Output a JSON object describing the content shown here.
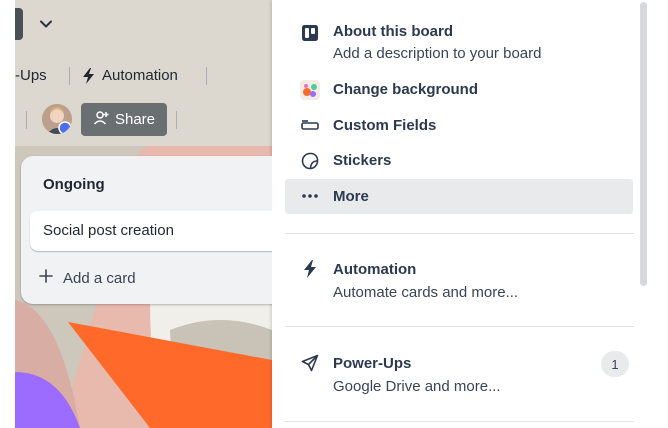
{
  "board": {
    "toolbar": {
      "powerups_label": "-Ups",
      "automation_label": "Automation",
      "share_label": "Share"
    },
    "list": {
      "title": "Ongoing",
      "cards": [
        {
          "title": "Social post creation"
        }
      ],
      "add_card_label": "Add a card"
    }
  },
  "menu": {
    "items": [
      {
        "icon": "board-icon",
        "title": "About this board",
        "subtitle": "Add a description to your board"
      },
      {
        "icon": "palette-icon",
        "title": "Change background"
      },
      {
        "icon": "custom-fields-icon",
        "title": "Custom Fields"
      },
      {
        "icon": "sticker-icon",
        "title": "Stickers"
      },
      {
        "icon": "more-icon",
        "title": "More"
      },
      {
        "icon": "lightning-icon",
        "title": "Automation",
        "subtitle": "Automate cards and more..."
      },
      {
        "icon": "rocket-icon",
        "title": "Power-Ups",
        "subtitle": "Google Drive and more...",
        "badge": "1"
      }
    ]
  },
  "colors": {
    "menu_text": "#2c3a4f",
    "highlight": "#e9eaec",
    "accent_orange": "#ff6a2b",
    "accent_purple": "#9c6bff",
    "share_button": "#6a6f72"
  }
}
